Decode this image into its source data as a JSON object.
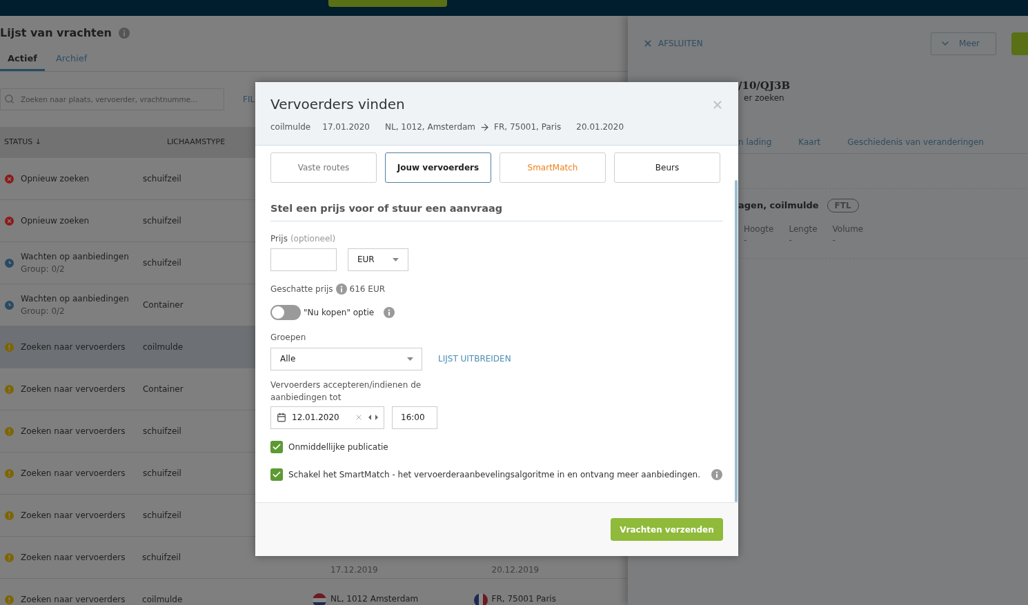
{
  "list": {
    "title": "Lijst van vrachten",
    "tabs": [
      {
        "label": "Actief",
        "selected": true
      },
      {
        "label": "Archief",
        "selected": false
      }
    ],
    "search": {
      "placeholder": "Zoeken naar plaats, vervoerder, vrachtnumme..."
    },
    "filter_link": "FIL",
    "columns": [
      "STATUS ↓",
      "LICHAAMSTYPE"
    ],
    "rows": [
      {
        "kind": "error",
        "status": "Opnieuw zoeken",
        "body": "schuifzeil",
        "selected": false
      },
      {
        "kind": "error",
        "status": "Opnieuw zoeken",
        "body": "schuifzeil",
        "selected": false
      },
      {
        "kind": "waiting",
        "status": "Wachten op aanbiedingen",
        "sub": "Group: 0/2",
        "body": "schuifzeil",
        "selected": false
      },
      {
        "kind": "waiting",
        "status": "Wachten op aanbiedingen",
        "sub": "Group: 0/2",
        "body": "Container",
        "selected": false
      },
      {
        "kind": "warning",
        "status": "Zoeken naar vervoerders",
        "body": "coilmulde",
        "selected": true
      },
      {
        "kind": "warning",
        "status": "Zoeken naar vervoerders",
        "body": "Container",
        "selected": false
      },
      {
        "kind": "warning",
        "status": "Zoeken naar vervoerders",
        "body": "schuifzeil",
        "selected": false
      },
      {
        "kind": "warning",
        "status": "Zoeken naar vervoerders",
        "body": "schuifzeil",
        "selected": false
      },
      {
        "kind": "warning",
        "status": "Zoeken naar vervoerders",
        "body": "schuifzeil",
        "selected": false
      },
      {
        "kind": "warning",
        "status": "Zoeken naar vervoerders",
        "body": "schuifzeil",
        "selected": false,
        "from": {
          "date": "17.12.2019"
        },
        "to": {
          "date": "20.12.2019"
        }
      },
      {
        "kind": "warning",
        "status": "Zoeken naar vervoerders",
        "body": "coilmulde",
        "selected": false,
        "from": {
          "place": "NL, 1012 Amsterdam"
        },
        "to": {
          "place": "FR, 75001 Paris"
        }
      }
    ]
  },
  "detail": {
    "close": "AFSLUITEN",
    "more": "Meer",
    "heading": "/10/QJ3B",
    "subtitle": "er zoeken",
    "tabs": [
      "n lading",
      "Kaart",
      "Geschiedenis van veranderingen"
    ],
    "card_title": "agen, coilmulde",
    "badge": "FTL",
    "fields": [
      {
        "label": "Hoogte",
        "value": "-"
      },
      {
        "label": "Lengte",
        "value": "-"
      },
      {
        "label": "Volume",
        "value": "-"
      }
    ]
  },
  "modal": {
    "title": "Vervoerders vinden",
    "meta": [
      "coilmulde",
      "17.01.2020",
      "NL, 1012, Amsterdam",
      "FR, 75001, Paris",
      "20.01.2020"
    ],
    "tabs": [
      {
        "label": "Vaste routes",
        "kind": "muted",
        "selected": false
      },
      {
        "label": "Jouw vervoerders",
        "kind": "normal",
        "selected": true
      },
      {
        "label": "SmartMatch",
        "kind": "highlight",
        "selected": false
      },
      {
        "label": "Beurs",
        "kind": "normal",
        "selected": false
      }
    ],
    "section_title": "Stel een prijs voor of stuur een aanvraag",
    "price_label": "Prijs",
    "price_hint": "(optioneel)",
    "currency": "EUR",
    "estimate_label": "Geschatte prijs",
    "estimate_value": "616 EUR",
    "buy_now": {
      "label": "\"Nu kopen\" optie",
      "on": false
    },
    "groups_label": "Groepen",
    "groups_value": "Alle",
    "expand_link": "LIJST UITBREIDEN",
    "deadline_label": "Vervoerders accepteren/indienen de aanbiedingen tot",
    "date": "12.01.2020",
    "time": "16:00",
    "checks": [
      {
        "label": "Onmiddellijke publicatie",
        "checked": true,
        "info": false
      },
      {
        "label": "Schakel het SmartMatch - het vervoerderaanbevelingsalgoritme in en ontvang meer aanbiedingen.",
        "checked": true,
        "info": true
      }
    ],
    "submit": "Vrachten verzenden"
  }
}
